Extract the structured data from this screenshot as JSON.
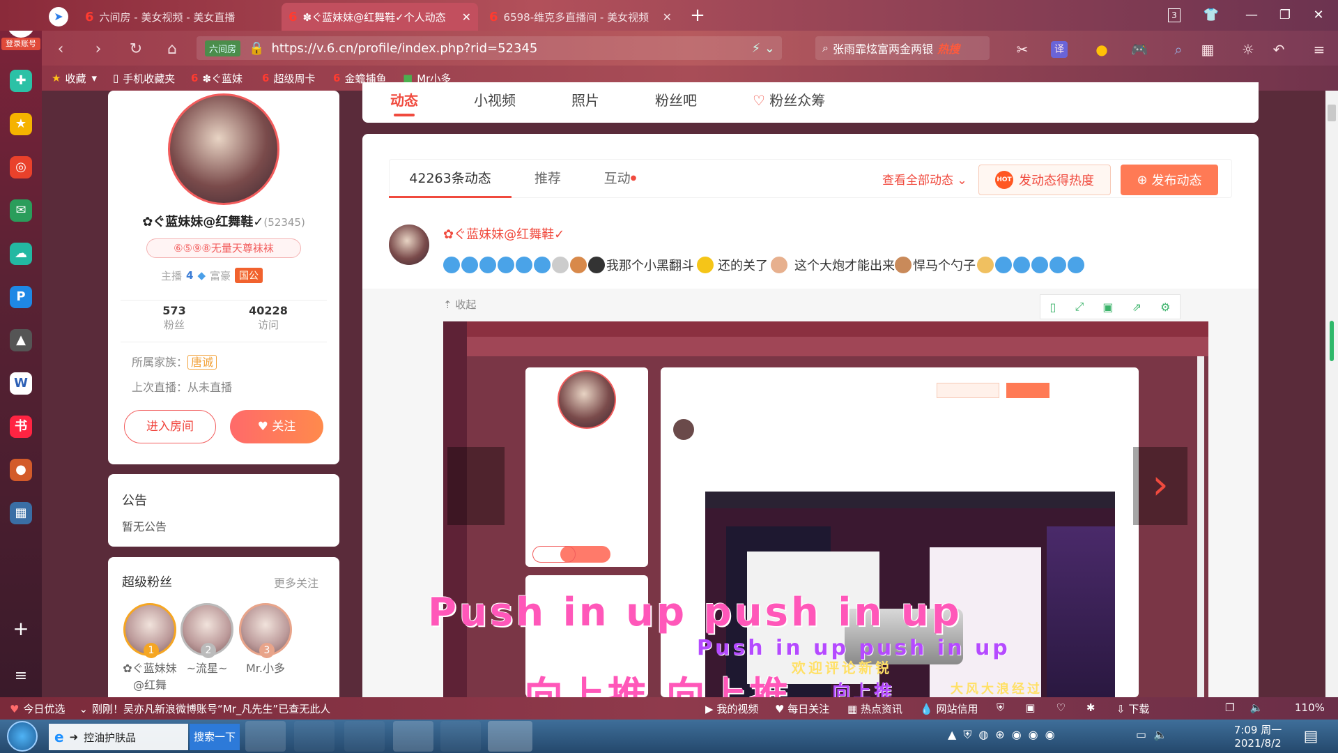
{
  "browser": {
    "login_label": "登录账号",
    "tabs": [
      {
        "title": "六间房 - 美女视频 - 美女直播"
      },
      {
        "title": "✽ぐ蓝妹妹@红舞鞋✓个人动态"
      },
      {
        "title": "6598-维克多直播间 - 美女视频"
      }
    ],
    "tab_count": "3",
    "url_badge": "六间房",
    "url": "https://v.6.cn/profile/index.php?rid=52345",
    "search_text": "张雨霏炫富两金两银",
    "search_hot": "热搜",
    "translate_label": "译",
    "bookmarks": [
      {
        "label": "收藏"
      },
      {
        "label": "手机收藏夹"
      },
      {
        "label": "✽ぐ蓝妹"
      },
      {
        "label": "超级周卡"
      },
      {
        "label": "金蟾捕鱼"
      },
      {
        "label": "Mr小多"
      }
    ]
  },
  "left_sidebar": {
    "icons": [
      {
        "name": "app-plus-icon",
        "color": "#2bc1a6"
      },
      {
        "name": "star-icon",
        "color": "#f5b300"
      },
      {
        "name": "weibo-icon",
        "color": "#e9412b"
      },
      {
        "name": "mail-icon",
        "color": "#2a9d5b"
      },
      {
        "name": "cloud-icon",
        "color": "#23b8a2"
      },
      {
        "name": "p-app-icon",
        "color": "#1e88e5"
      },
      {
        "name": "game-icon",
        "color": "#555"
      },
      {
        "name": "word-icon",
        "color": "#fff"
      },
      {
        "name": "xiaohongshu-icon",
        "color": "#ff2442"
      },
      {
        "name": "game2-icon",
        "color": "#d35b2a"
      },
      {
        "name": "game3-icon",
        "color": "#3a6ea5"
      }
    ],
    "add_label": "+",
    "menu_label": "≡"
  },
  "profile": {
    "nickname": "✿ぐ蓝妹妹@红舞鞋✓",
    "rid": "(52345)",
    "tag": "⑥⑤⑨⑧无量天尊袜袜",
    "anchor_label": "主播",
    "anchor_level": "4",
    "rich_label": "富豪",
    "rich_badge": "国公",
    "fans_count": "573",
    "fans_label": "粉丝",
    "visits_count": "40228",
    "visits_label": "访问",
    "family_label": "所属家族：",
    "family_value": "唐诚",
    "last_live_label": "上次直播：从未直播",
    "enter_room": "进入房间",
    "follow": "关注"
  },
  "notice": {
    "title": "公告",
    "content": "暂无公告"
  },
  "super_fans": {
    "title": "超级粉丝",
    "more": "更多关注",
    "items": [
      {
        "rank": "1",
        "name": "✿ぐ蓝妹妹@红舞",
        "color": "#f5a623"
      },
      {
        "rank": "2",
        "name": "~流星~",
        "color": "#bbb"
      },
      {
        "rank": "3",
        "name": "Mr.小多",
        "color": "#e8a48a"
      }
    ]
  },
  "top_nav": {
    "items": [
      {
        "label": "动态",
        "active": true
      },
      {
        "label": "小视频",
        "active": false
      },
      {
        "label": "照片",
        "active": false
      },
      {
        "label": "粉丝吧",
        "active": false
      },
      {
        "label": "粉丝众筹",
        "active": false
      }
    ]
  },
  "feed": {
    "tabs": [
      {
        "label": "42263条动态",
        "active": true
      },
      {
        "label": "推荐",
        "active": false
      },
      {
        "label": "互动",
        "active": false
      }
    ],
    "view_all": "查看全部动态",
    "hot_btn": "发动态得热度",
    "hot_badge": "HOT",
    "publish_btn": "发布动态",
    "post": {
      "author": "✿ぐ蓝妹妹@红舞鞋✓",
      "text1": "我那个小黑翻斗",
      "text2": "还的关了",
      "text3": "这个大炮才能出来",
      "text4": "悍马个勺子"
    },
    "collapse": "收起"
  },
  "subtitles": {
    "line1": "Push in up push in up",
    "line2": "Push in up push in up",
    "line3": "向上推 向上推",
    "line4": "向上推",
    "overlay1": "欢迎评论新锐",
    "overlay2": "大风大浪经过"
  },
  "statusbar": {
    "news_label": "今日优选",
    "news": "刚刚！吴亦凡新浪微博账号“Mr_凡先生”已查无此人",
    "items": [
      {
        "label": "我的视频"
      },
      {
        "label": "每日关注"
      },
      {
        "label": "热点资讯"
      },
      {
        "label": "网站信用"
      },
      {
        "label": "下载"
      }
    ],
    "zoom": "110%"
  },
  "taskbar": {
    "ie_task": "控油护肤品",
    "search_btn": "搜索一下",
    "time": "7:09 周一",
    "date": "2021/8/2"
  }
}
